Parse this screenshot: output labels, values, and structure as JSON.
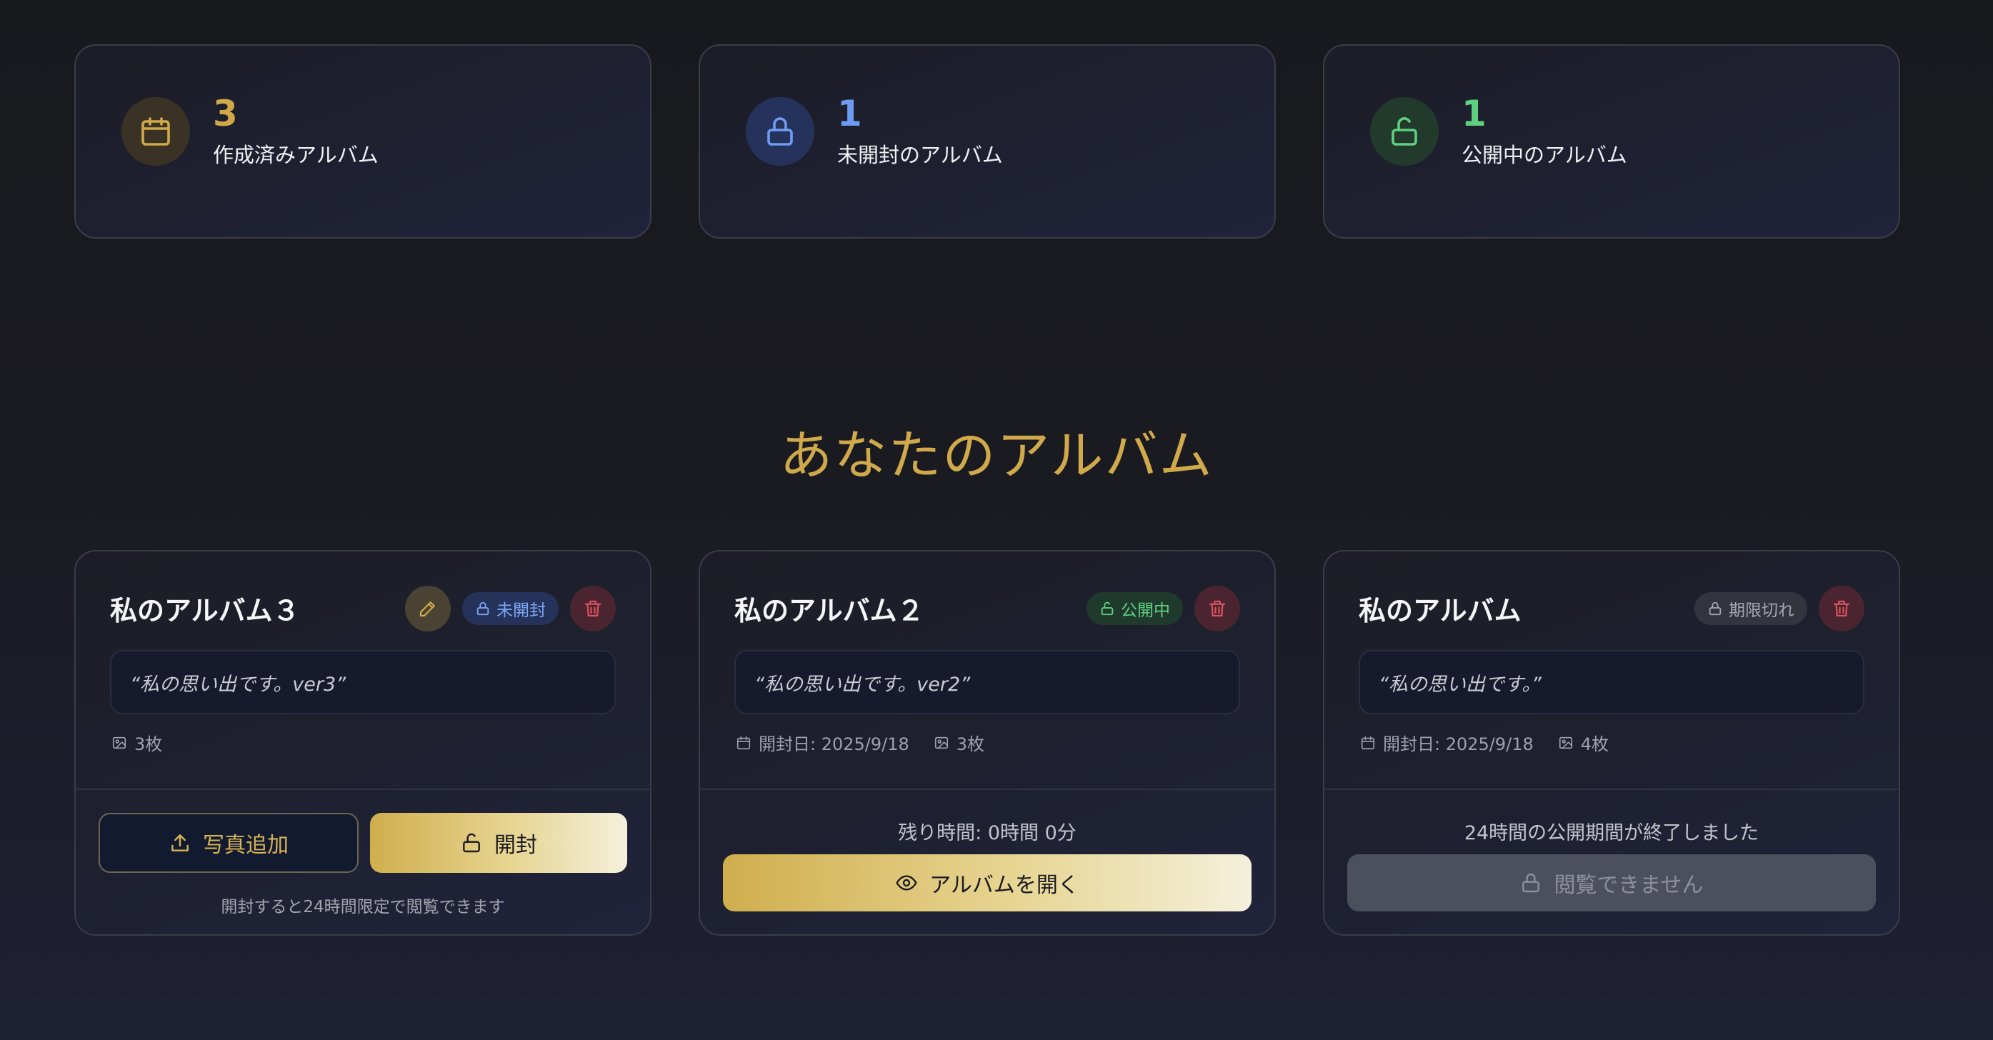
{
  "colors": {
    "accent_gold": "#d0a94a",
    "accent_blue": "#7ea6f4",
    "accent_green": "#5fd07f",
    "danger_red": "#d9525e"
  },
  "stats": [
    {
      "value": "3",
      "label": "作成済みアルバム",
      "icon": "calendar-icon",
      "color": "#d0a94a"
    },
    {
      "value": "1",
      "label": "未開封のアルバム",
      "icon": "lock-icon",
      "color": "#6f9cf3"
    },
    {
      "value": "1",
      "label": "公開中のアルバム",
      "icon": "lock-open-icon",
      "color": "#5fd07f"
    }
  ],
  "section_title": "あなたのアルバム",
  "albums": [
    {
      "title": "私のアルバム３",
      "status": "未開封",
      "quote": "“私の思い出です。ver3”",
      "photos": "3枚",
      "add_photo_label": "写真追加",
      "open_label": "開封",
      "hint": "開封すると24時間限定で閲覧できます"
    },
    {
      "title": "私のアルバム２",
      "status": "公開中",
      "quote": "“私の思い出です。ver2”",
      "open_date": "開封日: 2025/9/18",
      "photos": "3枚",
      "remaining": "残り時間: 0時間 0分",
      "view_label": "アルバムを開く"
    },
    {
      "title": "私のアルバム",
      "status": "期限切れ",
      "quote": "“私の思い出です。”",
      "open_date": "開封日: 2025/9/18",
      "photos": "4枚",
      "expired_message": "24時間の公開期間が終了しました",
      "disabled_label": "閲覧できません"
    }
  ]
}
